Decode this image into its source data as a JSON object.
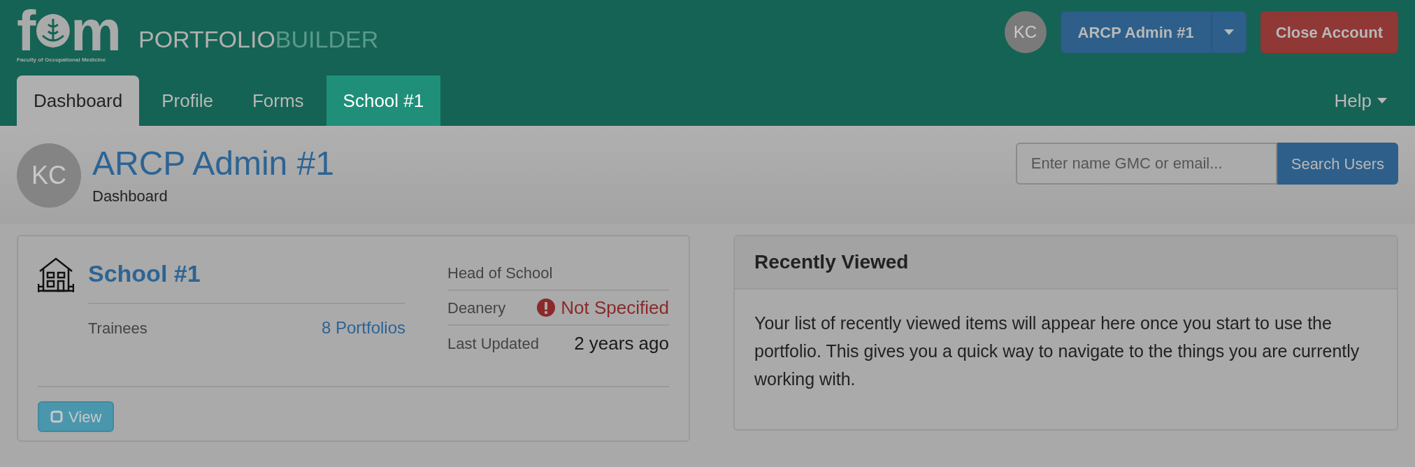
{
  "logo": {
    "letters": [
      "f",
      "m"
    ],
    "subtitle": "Faculty of Occupational Medicine"
  },
  "brand": {
    "first": "PORTFOLIO",
    "second": "BUILDER"
  },
  "user_menu": {
    "avatar": "KC",
    "name": "ARCP Admin #1",
    "close_button": "Close Account"
  },
  "tabs": [
    {
      "label": "Dashboard",
      "selected": true,
      "highlighted": false
    },
    {
      "label": "Profile",
      "selected": false,
      "highlighted": false
    },
    {
      "label": "Forms",
      "selected": false,
      "highlighted": false
    },
    {
      "label": "School #1",
      "selected": false,
      "highlighted": true
    }
  ],
  "help": "Help",
  "page_header": {
    "avatar": "KC",
    "title": "ARCP Admin #1",
    "subtitle": "Dashboard"
  },
  "search": {
    "placeholder": "Enter name GMC or email...",
    "button": "Search Users"
  },
  "school_card": {
    "title": "School #1",
    "trainees_label": "Trainees",
    "trainees_link": "8 Portfolios",
    "details": [
      {
        "label": "Head of School",
        "kind": "empty"
      },
      {
        "label": "Deanery",
        "value": "Not Specified",
        "kind": "warning"
      },
      {
        "label": "Last Updated",
        "value": "2 years ago",
        "kind": "text"
      }
    ],
    "view_button": "View"
  },
  "recent": {
    "title": "Recently Viewed",
    "text": "Your list of recently viewed items will appear here once you start to use the portfolio. This gives you a quick way to navigate to the things you are currently working with."
  }
}
